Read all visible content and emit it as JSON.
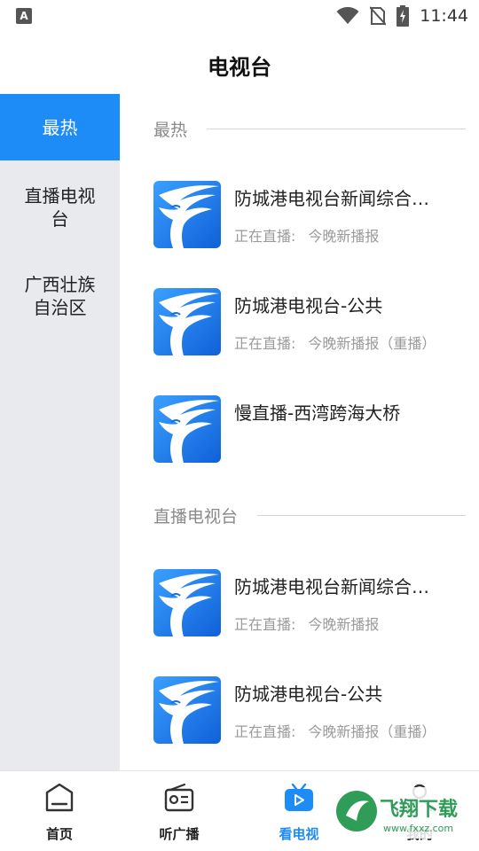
{
  "status_bar": {
    "time": "11:44",
    "left_badge": "A"
  },
  "header": {
    "title": "电视台"
  },
  "sidebar": {
    "items": [
      {
        "label": "最热",
        "active": true
      },
      {
        "label": "直播电视台",
        "active": false
      },
      {
        "label": "广西壮族自治区",
        "active": false
      }
    ]
  },
  "sections": [
    {
      "title": "最热",
      "channels": [
        {
          "name": "防城港电视台新闻综合频道",
          "live_prefix": "正在直播:",
          "program": "今晚新播报"
        },
        {
          "name": "防城港电视台-公共",
          "live_prefix": "正在直播:",
          "program": "今晚新播报（重播）"
        },
        {
          "name": "慢直播-西湾跨海大桥",
          "live_prefix": "",
          "program": ""
        }
      ]
    },
    {
      "title": "直播电视台",
      "channels": [
        {
          "name": "防城港电视台新闻综合频道",
          "live_prefix": "正在直播:",
          "program": "今晚新播报"
        },
        {
          "name": "防城港电视台-公共",
          "live_prefix": "正在直播:",
          "program": "今晚新播报（重播）"
        }
      ]
    }
  ],
  "bottom_nav": {
    "items": [
      {
        "label": "首页",
        "icon": "home-icon",
        "active": false
      },
      {
        "label": "听广播",
        "icon": "radio-icon",
        "active": false
      },
      {
        "label": "看电视",
        "icon": "tv-icon",
        "active": true
      },
      {
        "label": "我的",
        "icon": "user-icon",
        "active": false
      }
    ]
  },
  "watermark": {
    "text": "飞翔下载",
    "site": "www.fxxz.com"
  },
  "colors": {
    "accent": "#1e8cf7",
    "sidebar_bg": "#e9eaee",
    "logo_blue": "#1a7be8"
  }
}
